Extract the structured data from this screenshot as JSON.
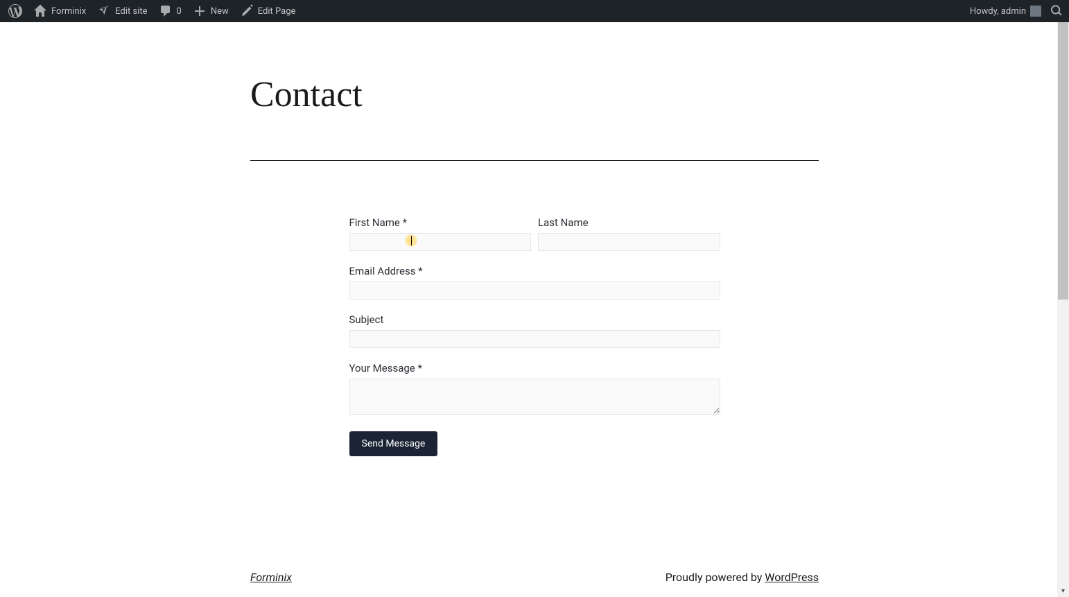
{
  "adminbar": {
    "wp_icon": "wordpress-logo",
    "site_name": "Forminix",
    "edit_site": "Edit site",
    "comments_count": "0",
    "new_label": "New",
    "edit_page": "Edit Page",
    "greeting": "Howdy, admin"
  },
  "page": {
    "title": "Contact"
  },
  "form": {
    "first_name_label": "First Name *",
    "last_name_label": "Last Name",
    "email_label": "Email Address *",
    "subject_label": "Subject",
    "message_label": "Your Message *",
    "submit_label": "Send Message"
  },
  "footer": {
    "site_link": "Forminix",
    "powered_prefix": "Proudly powered by ",
    "powered_link": "WordPress"
  }
}
